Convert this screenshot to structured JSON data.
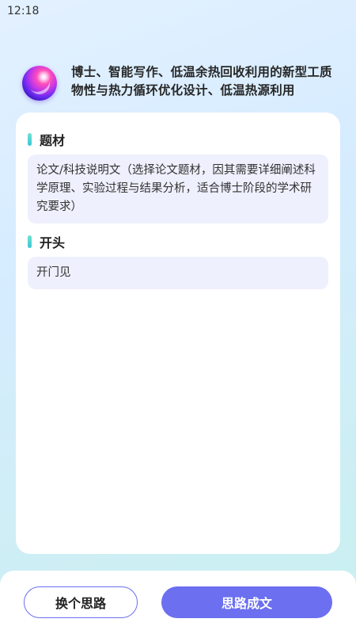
{
  "status_bar": {
    "time": "12:18"
  },
  "header": {
    "title": "博士、智能写作、低温余热回收利用的新型工质物性与热力循环优化设计、低温热源利用"
  },
  "sections": [
    {
      "title": "题材",
      "content": "论文/科技说明文（选择论文题材，因其需要详细阐述科学原理、实验过程与结果分析，适合博士阶段的学术研究要求）"
    },
    {
      "title": "开头",
      "content": "开门见"
    }
  ],
  "actions": {
    "change_idea": "换个思路",
    "generate": "思路成文"
  },
  "colors": {
    "accent": "#6b6ff0",
    "section_bar": "#3ac6d6",
    "content_box_bg": "#eef0fd"
  }
}
